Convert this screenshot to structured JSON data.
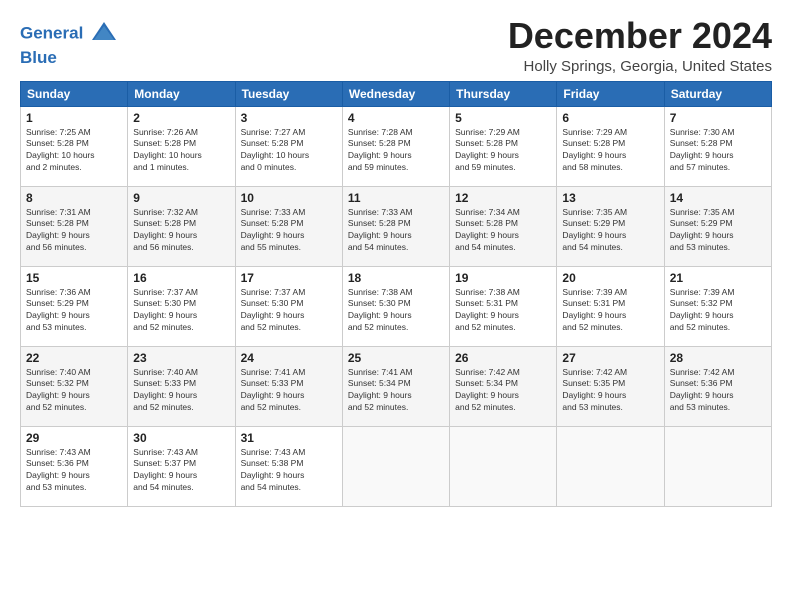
{
  "header": {
    "logo_line1": "General",
    "logo_line2": "Blue",
    "month": "December 2024",
    "location": "Holly Springs, Georgia, United States"
  },
  "weekdays": [
    "Sunday",
    "Monday",
    "Tuesday",
    "Wednesday",
    "Thursday",
    "Friday",
    "Saturday"
  ],
  "weeks": [
    [
      {
        "day": "1",
        "sunrise": "7:25 AM",
        "sunset": "5:28 PM",
        "daylight": "10 hours and 2 minutes."
      },
      {
        "day": "2",
        "sunrise": "7:26 AM",
        "sunset": "5:28 PM",
        "daylight": "10 hours and 1 minute."
      },
      {
        "day": "3",
        "sunrise": "7:27 AM",
        "sunset": "5:28 PM",
        "daylight": "10 hours and 0 minutes."
      },
      {
        "day": "4",
        "sunrise": "7:28 AM",
        "sunset": "5:28 PM",
        "daylight": "9 hours and 59 minutes."
      },
      {
        "day": "5",
        "sunrise": "7:29 AM",
        "sunset": "5:28 PM",
        "daylight": "9 hours and 59 minutes."
      },
      {
        "day": "6",
        "sunrise": "7:29 AM",
        "sunset": "5:28 PM",
        "daylight": "9 hours and 58 minutes."
      },
      {
        "day": "7",
        "sunrise": "7:30 AM",
        "sunset": "5:28 PM",
        "daylight": "9 hours and 57 minutes."
      }
    ],
    [
      {
        "day": "8",
        "sunrise": "7:31 AM",
        "sunset": "5:28 PM",
        "daylight": "9 hours and 56 minutes."
      },
      {
        "day": "9",
        "sunrise": "7:32 AM",
        "sunset": "5:28 PM",
        "daylight": "9 hours and 56 minutes."
      },
      {
        "day": "10",
        "sunrise": "7:33 AM",
        "sunset": "5:28 PM",
        "daylight": "9 hours and 55 minutes."
      },
      {
        "day": "11",
        "sunrise": "7:33 AM",
        "sunset": "5:28 PM",
        "daylight": "9 hours and 54 minutes."
      },
      {
        "day": "12",
        "sunrise": "7:34 AM",
        "sunset": "5:28 PM",
        "daylight": "9 hours and 54 minutes."
      },
      {
        "day": "13",
        "sunrise": "7:35 AM",
        "sunset": "5:29 PM",
        "daylight": "9 hours and 54 minutes."
      },
      {
        "day": "14",
        "sunrise": "7:35 AM",
        "sunset": "5:29 PM",
        "daylight": "9 hours and 53 minutes."
      }
    ],
    [
      {
        "day": "15",
        "sunrise": "7:36 AM",
        "sunset": "5:29 PM",
        "daylight": "9 hours and 53 minutes."
      },
      {
        "day": "16",
        "sunrise": "7:37 AM",
        "sunset": "5:30 PM",
        "daylight": "9 hours and 52 minutes."
      },
      {
        "day": "17",
        "sunrise": "7:37 AM",
        "sunset": "5:30 PM",
        "daylight": "9 hours and 52 minutes."
      },
      {
        "day": "18",
        "sunrise": "7:38 AM",
        "sunset": "5:30 PM",
        "daylight": "9 hours and 52 minutes."
      },
      {
        "day": "19",
        "sunrise": "7:38 AM",
        "sunset": "5:31 PM",
        "daylight": "9 hours and 52 minutes."
      },
      {
        "day": "20",
        "sunrise": "7:39 AM",
        "sunset": "5:31 PM",
        "daylight": "9 hours and 52 minutes."
      },
      {
        "day": "21",
        "sunrise": "7:39 AM",
        "sunset": "5:32 PM",
        "daylight": "9 hours and 52 minutes."
      }
    ],
    [
      {
        "day": "22",
        "sunrise": "7:40 AM",
        "sunset": "5:32 PM",
        "daylight": "9 hours and 52 minutes."
      },
      {
        "day": "23",
        "sunrise": "7:40 AM",
        "sunset": "5:33 PM",
        "daylight": "9 hours and 52 minutes."
      },
      {
        "day": "24",
        "sunrise": "7:41 AM",
        "sunset": "5:33 PM",
        "daylight": "9 hours and 52 minutes."
      },
      {
        "day": "25",
        "sunrise": "7:41 AM",
        "sunset": "5:34 PM",
        "daylight": "9 hours and 52 minutes."
      },
      {
        "day": "26",
        "sunrise": "7:42 AM",
        "sunset": "5:34 PM",
        "daylight": "9 hours and 52 minutes."
      },
      {
        "day": "27",
        "sunrise": "7:42 AM",
        "sunset": "5:35 PM",
        "daylight": "9 hours and 53 minutes."
      },
      {
        "day": "28",
        "sunrise": "7:42 AM",
        "sunset": "5:36 PM",
        "daylight": "9 hours and 53 minutes."
      }
    ],
    [
      {
        "day": "29",
        "sunrise": "7:43 AM",
        "sunset": "5:36 PM",
        "daylight": "9 hours and 53 minutes."
      },
      {
        "day": "30",
        "sunrise": "7:43 AM",
        "sunset": "5:37 PM",
        "daylight": "9 hours and 54 minutes."
      },
      {
        "day": "31",
        "sunrise": "7:43 AM",
        "sunset": "5:38 PM",
        "daylight": "9 hours and 54 minutes."
      },
      null,
      null,
      null,
      null
    ]
  ]
}
